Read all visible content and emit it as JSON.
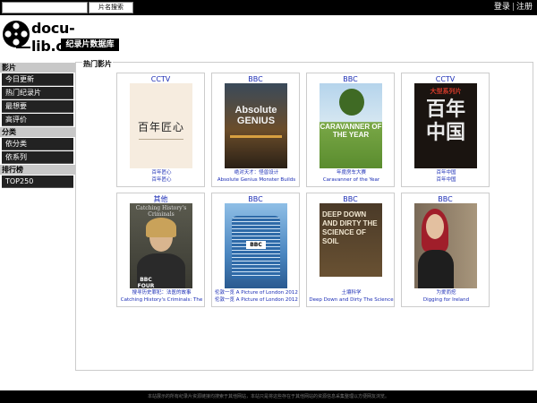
{
  "search": {
    "placeholder": "",
    "button_label": "片名搜索"
  },
  "user": {
    "login": "登录",
    "separator": "|",
    "register": "注册"
  },
  "logo": {
    "text": "docu-lib.com",
    "subtitle": "纪录片数据库",
    "icon": "film-reel-icon"
  },
  "sidebar": {
    "sections": [
      {
        "heading": "影片",
        "items": [
          "今日更新",
          "热门纪录片",
          "最想要",
          "高评价"
        ]
      },
      {
        "heading": "分类",
        "items": [
          "依分类",
          "依系列"
        ]
      },
      {
        "heading": "排行榜",
        "items": [
          "TOP250"
        ]
      }
    ]
  },
  "main": {
    "title": "热门影片",
    "cards": [
      {
        "source": "CCTV",
        "title_cn": "百年匠心",
        "title_en": "百年匠心",
        "poster_text": "百年匠心"
      },
      {
        "source": "BBC",
        "title_cn": "绝对天才：怪兽设计",
        "title_en": "Absolute Genius Monster Builds",
        "poster_text": "Absolute GENIUS"
      },
      {
        "source": "BBC",
        "title_cn": "年度房车大赛",
        "title_en": "Caravanner of the Year",
        "poster_text": "CARAVANNER OF THE YEAR"
      },
      {
        "source": "CCTV",
        "title_cn": "百年中国",
        "title_en": "百年中国",
        "poster_text": "百年中国",
        "poster_sub": "大型系列片"
      },
      {
        "source": "其他",
        "title_cn": "搜寻历史罪犯：法医的故事",
        "title_en": "Catching History's Criminals: The",
        "poster_text": "Catching History's Criminals",
        "poster_brand": "BBC FOUR"
      },
      {
        "source": "BBC",
        "title_cn": "伦敦一览 A Picture of London 2012",
        "title_en": "伦敦一览 A Picture of London 2012",
        "poster_text": "BBC"
      },
      {
        "source": "BBC",
        "title_cn": "土壤科学",
        "title_en": "Deep Down and Dirty The Science",
        "poster_text": "DEEP DOWN AND DIRTY THE SCIENCE OF SOIL"
      },
      {
        "source": "BBC",
        "title_cn": "为爱而挖",
        "title_en": "Digging for Ireland",
        "poster_text": ""
      }
    ]
  },
  "footer": {
    "text": "本站展示的所有纪录片资源链接均搜索于其他网站，本站只是将这些存在于其他网站的资源信息采集整理以方便网友浏览。"
  }
}
